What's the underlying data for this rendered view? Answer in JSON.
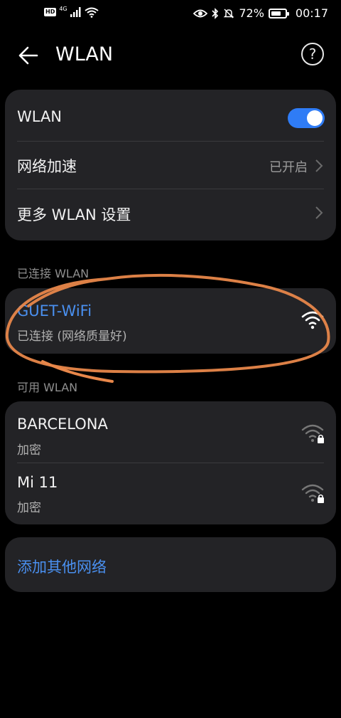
{
  "status_bar": {
    "hd": "HD",
    "network": "4G",
    "battery": "72%",
    "battery_level": 0.72,
    "time": "00:17"
  },
  "app_bar": {
    "title": "WLAN",
    "help": "?"
  },
  "settings": {
    "wlan_label": "WLAN",
    "wlan_on": true,
    "accel_label": "网络加速",
    "accel_value": "已开启",
    "more_label": "更多 WLAN 设置"
  },
  "connected": {
    "section_label": "已连接 WLAN",
    "name": "GUET-WiFi",
    "status": "已连接 (网络质量好)"
  },
  "available": {
    "section_label": "可用 WLAN",
    "networks": [
      {
        "name": "BARCELONA",
        "security": "加密"
      },
      {
        "name": "Mi 11",
        "security": "加密"
      }
    ]
  },
  "add_network": {
    "label": "添加其他网络"
  },
  "colors": {
    "accent": "#4a90f0",
    "toggle_on": "#2f7cf6",
    "card": "#232326",
    "annotation": "#e8874a"
  }
}
